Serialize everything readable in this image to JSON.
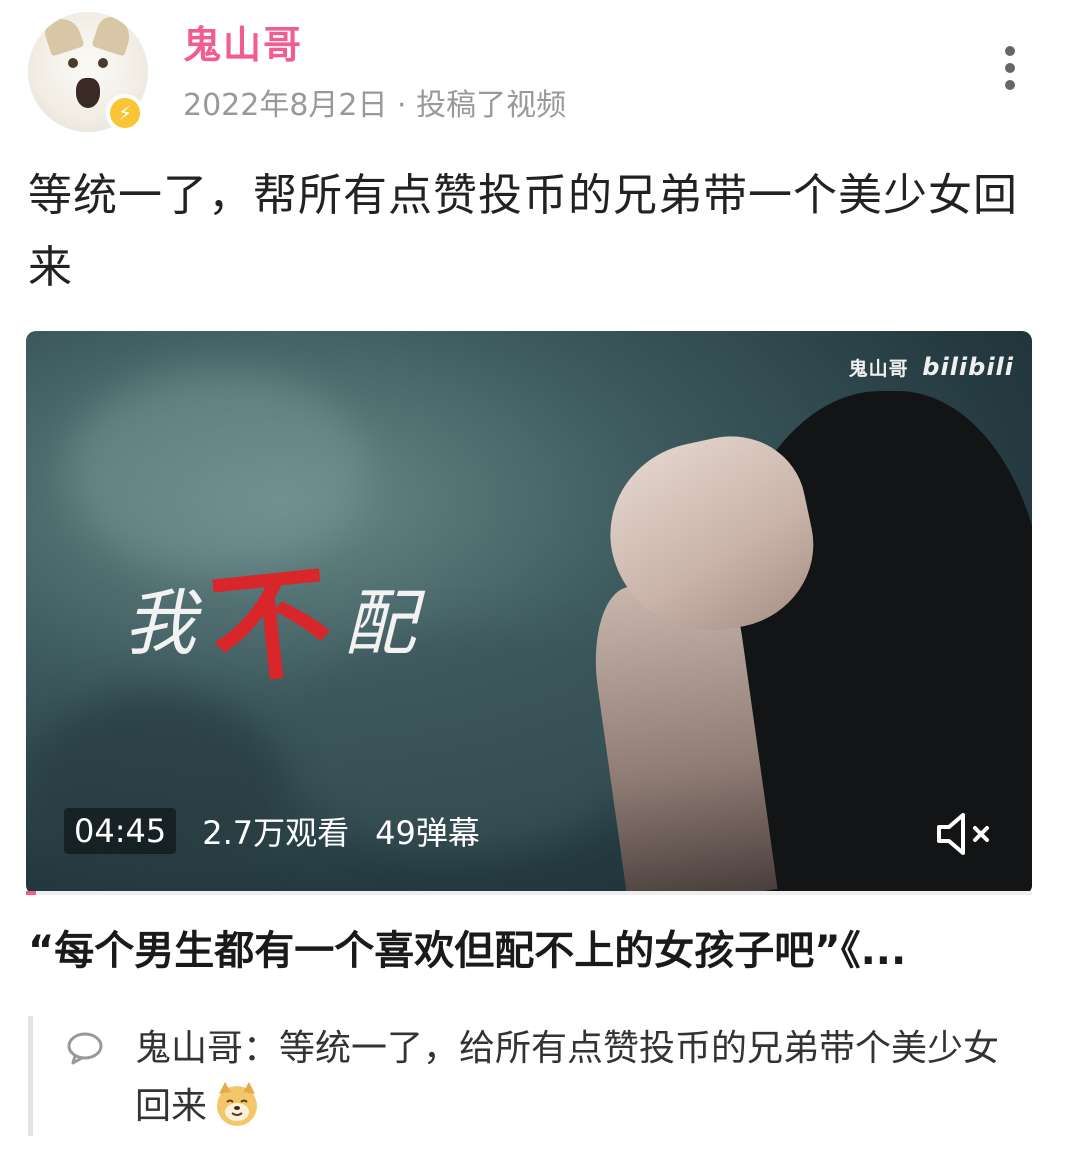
{
  "header": {
    "username": "鬼山哥",
    "meta": "2022年8月2日 · 投稿了视频",
    "avatar_icon": "cat-avatar",
    "badge_icon": "lightning-icon",
    "more_icon": "more-vertical-icon"
  },
  "post": {
    "text": "等统一了，帮所有点赞投币的兄弟带一个美少女回来"
  },
  "video": {
    "watermark_name": "鬼山哥",
    "watermark_brand": "bilibili",
    "art_chars": [
      "我",
      "不",
      "配"
    ],
    "duration": "04:45",
    "views": "2.7万观看",
    "danmaku": "49弹幕",
    "mute_icon": "volume-muted-icon",
    "progress": 0.01,
    "accent": "#f25d8e"
  },
  "video_title": "“每个男生都有一个喜欢但配不上的女孩子吧”《...",
  "comment": {
    "author": "鬼山哥：",
    "text": "等统一了，给所有点赞投币的兄弟带个美少女回来",
    "emoji": "doge-emoji"
  }
}
